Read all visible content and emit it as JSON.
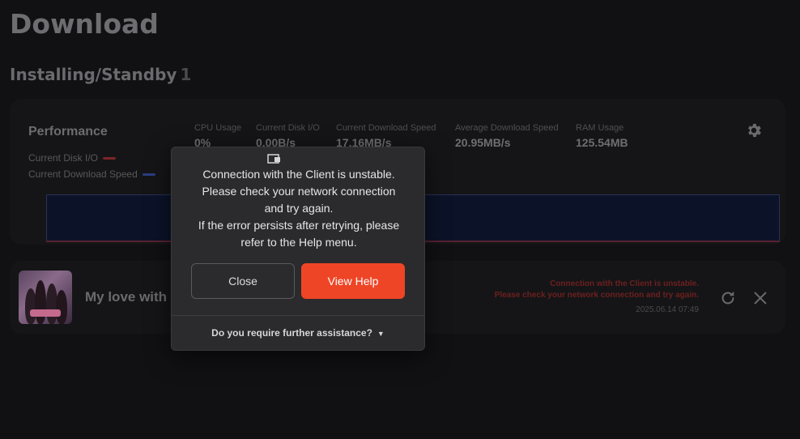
{
  "page": {
    "title": "Download"
  },
  "section": {
    "title": "Installing/Standby",
    "count": "1"
  },
  "performance": {
    "title": "Performance",
    "legend": [
      {
        "label": "Current Disk I/O",
        "color": "#c0393b"
      },
      {
        "label": "Current Download Speed",
        "color": "#3b5bc4"
      }
    ],
    "stats": [
      {
        "label": "CPU Usage",
        "value": "0%"
      },
      {
        "label": "Current Disk I/O",
        "value": "0.00B/s"
      },
      {
        "label": "Current Download Speed",
        "value": "17.16MB/s"
      },
      {
        "label": "Average Download Speed",
        "value": "20.95MB/s"
      },
      {
        "label": "RAM Usage",
        "value": "125.54MB"
      }
    ],
    "settings_icon": "gear-icon"
  },
  "item": {
    "title": "My love with t",
    "error_line1": "Connection with the Client is unstable.",
    "error_line2": "Please check your network connection and try again.",
    "timestamp": "2025.06.14 07:49",
    "retry_icon": "refresh-icon",
    "remove_icon": "close-icon"
  },
  "modal": {
    "icon": "network-warning-icon",
    "message_lines": [
      "Connection with the Client is unstable.",
      "Please check your network connection",
      "and try again.",
      "If the error persists after retrying, please",
      "refer to the Help menu."
    ],
    "close_label": "Close",
    "help_label": "View Help",
    "footer_label": "Do you require further assistance?",
    "accent_color": "#ee4526"
  }
}
